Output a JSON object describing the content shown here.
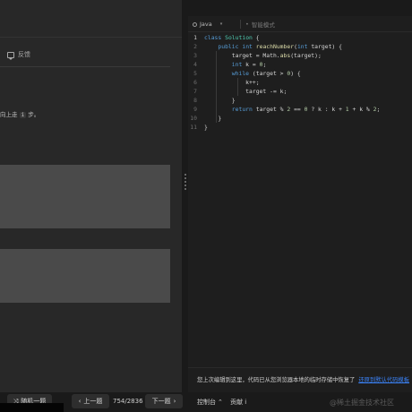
{
  "left": {
    "feedback_label": "反馈",
    "desc_prefix": "向上走",
    "desc_code": "i",
    "desc_suffix": "步。"
  },
  "editor": {
    "language": "Java",
    "smart_mode_label": "智能模式",
    "code_lines": [
      "class Solution {",
      "    public int reachNumber(int target) {",
      "        target = Math.abs(target);",
      "        int k = 0;",
      "        while (target > 0) {",
      "            k++;",
      "            target -= k;",
      "        }",
      "        return target % 2 == 0 ? k : k + 1 + k % 2;",
      "    }",
      "}"
    ],
    "line_numbers": [
      "1",
      "2",
      "3",
      "4",
      "5",
      "6",
      "7",
      "8",
      "9",
      "10",
      "11"
    ]
  },
  "restore": {
    "message": "您上次编辑到这里，代码已从您浏览器本地的临时存储中恢复了",
    "link_label": "还原到默认代码模板"
  },
  "bottom": {
    "random_label": "随机一题",
    "prev_label": "上一题",
    "counter": "754/2836",
    "next_label": "下一题",
    "console_label": "控制台",
    "contribute_label": "贡献 i"
  },
  "watermark": "@稀土掘金技术社区",
  "colors": {
    "keyword": "#569cd6",
    "type": "#4ec9b0",
    "function": "#dcdcaa",
    "number": "#b5cea8",
    "link": "#3b82f6"
  }
}
